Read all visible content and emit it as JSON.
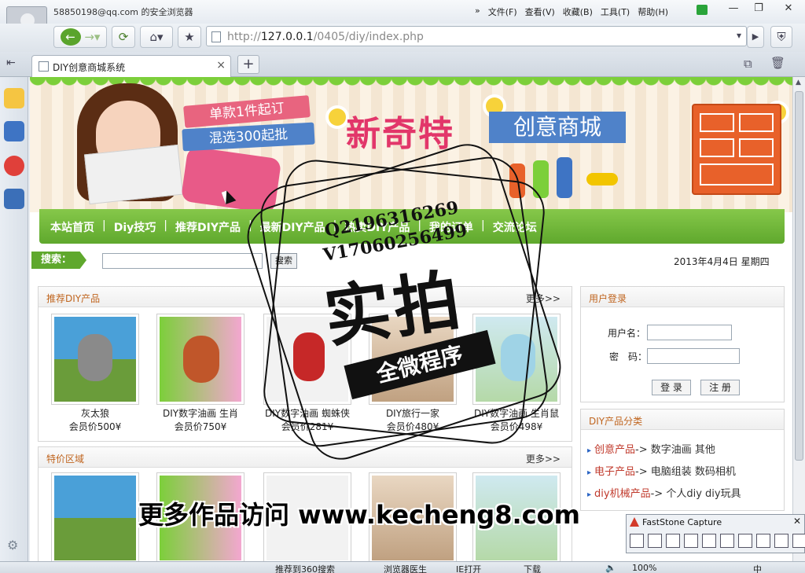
{
  "browser": {
    "account": "58850198@qq.com 的安全浏览器",
    "menus": [
      "文件(F)",
      "查看(V)",
      "收藏(B)",
      "工具(T)",
      "帮助(H)"
    ],
    "url_prefix": "http://",
    "url_host": "127.0.0.1",
    "url_path": "/0405/diy/index.php",
    "tab_title": "DIY创意商城系统",
    "icons": [
      "back-icon",
      "forward-icon",
      "refresh-icon",
      "home-icon",
      "star-icon",
      "shield-icon"
    ]
  },
  "banner": {
    "badge1": "单款1件起订",
    "badge2": "混选300起批",
    "brand1": "新奇特",
    "brand2": "创意商城"
  },
  "nav": {
    "items": [
      "本站首页",
      "Diy技巧",
      "推荐DIY产品",
      "最新DIY产品",
      "热卖DIY产品",
      "我的订单",
      "交流论坛"
    ]
  },
  "search": {
    "label": "搜索：",
    "button": "搜索",
    "date": "2013年4月4日 星期四"
  },
  "recommend": {
    "title": "推荐DIY产品",
    "more": "更多>>",
    "products": [
      {
        "name": "灰太狼",
        "price": "会员价500¥"
      },
      {
        "name": "DIY数字油画 生肖",
        "price": "会员价750¥"
      },
      {
        "name": "DIY数字油画 蜘蛛侠",
        "price": "会员价281¥"
      },
      {
        "name": "DIY旅行一家",
        "price": "会员价480¥"
      },
      {
        "name": "DIY数字油画 生肖鼠",
        "price": "会员价498¥"
      }
    ]
  },
  "special": {
    "title": "特价区域",
    "more": "更多>>"
  },
  "login": {
    "title": "用户登录",
    "username_label": "用户名：",
    "password_label": "密　码：",
    "login_button": "登 录",
    "register_button": "注 册"
  },
  "categories": {
    "title": "DIY产品分类",
    "rows": [
      {
        "name": "创意产品",
        "arrow": "->",
        "subs": "数字油画  其他"
      },
      {
        "name": "电子产品",
        "arrow": "->",
        "subs": "电脑组装  数码相机"
      },
      {
        "name": "diy机械产品",
        "arrow": "->",
        "subs": "个人diy  diy玩具"
      }
    ]
  },
  "watermark": {
    "qq": "Q2196316269",
    "wx": "V17060256499",
    "big": "实拍",
    "ribbon": "全微程序",
    "url": "更多作品访问 www.kecheng8.com"
  },
  "faststone": {
    "title": "FastStone Capture"
  },
  "status": {
    "recommend": "推荐到360搜索",
    "doctor": "浏览器医生",
    "ie": "IE打开",
    "download": "下载",
    "zoom": "100%",
    "ime": "中"
  }
}
